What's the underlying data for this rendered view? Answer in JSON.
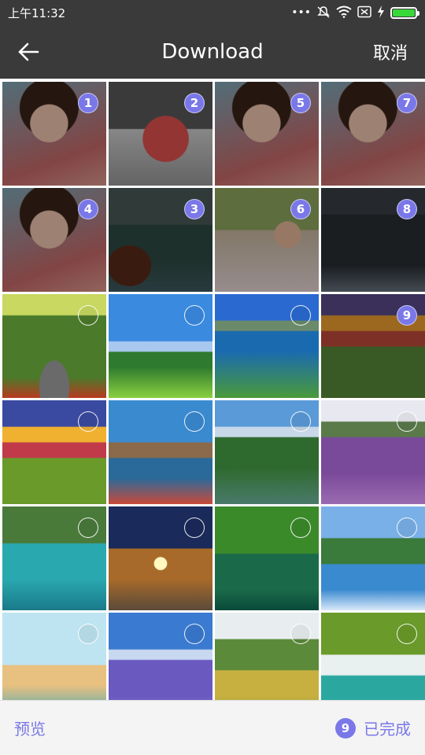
{
  "status_bar": {
    "time": "上午11:32",
    "icons": [
      "dots-icon",
      "mute-icon",
      "wifi-icon",
      "sim-icon",
      "charging-icon",
      "battery-icon"
    ],
    "battery_color": "#38d73a"
  },
  "header": {
    "title": "Download",
    "cancel_label": "取消",
    "back_icon": "back-arrow-icon"
  },
  "photos": [
    {
      "subject": "woman-portrait",
      "selected": true,
      "order": "1"
    },
    {
      "subject": "woman-red-dress",
      "selected": true,
      "order": "2"
    },
    {
      "subject": "woman-portrait",
      "selected": true,
      "order": "5"
    },
    {
      "subject": "woman-portrait",
      "selected": true,
      "order": "7"
    },
    {
      "subject": "woman-portrait",
      "selected": true,
      "order": "4"
    },
    {
      "subject": "mountain-ship",
      "selected": true,
      "order": "3"
    },
    {
      "subject": "woman-outdoor",
      "selected": true,
      "order": "6"
    },
    {
      "subject": "castle",
      "selected": true,
      "order": "8"
    },
    {
      "subject": "forest-road",
      "selected": false,
      "order": ""
    },
    {
      "subject": "green-field-sky",
      "selected": false,
      "order": ""
    },
    {
      "subject": "coast-hills",
      "selected": false,
      "order": ""
    },
    {
      "subject": "sunset-field",
      "selected": true,
      "order": "9"
    },
    {
      "subject": "sunset-path",
      "selected": false,
      "order": ""
    },
    {
      "subject": "windmill",
      "selected": false,
      "order": ""
    },
    {
      "subject": "mountain-lake",
      "selected": false,
      "order": ""
    },
    {
      "subject": "lavender-field",
      "selected": false,
      "order": ""
    },
    {
      "subject": "turquoise-lake",
      "selected": false,
      "order": ""
    },
    {
      "subject": "night-street",
      "selected": false,
      "order": ""
    },
    {
      "subject": "green-lake",
      "selected": false,
      "order": ""
    },
    {
      "subject": "rainbow-coast",
      "selected": false,
      "order": ""
    },
    {
      "subject": "tropical-beach",
      "selected": false,
      "order": ""
    },
    {
      "subject": "lavender-sky",
      "selected": false,
      "order": ""
    },
    {
      "subject": "hill-cabin",
      "selected": false,
      "order": ""
    },
    {
      "subject": "waterfall",
      "selected": false,
      "order": ""
    }
  ],
  "footer": {
    "preview_label": "预览",
    "selected_count": "9",
    "done_label": "已完成",
    "accent_color": "#7a78e8"
  }
}
